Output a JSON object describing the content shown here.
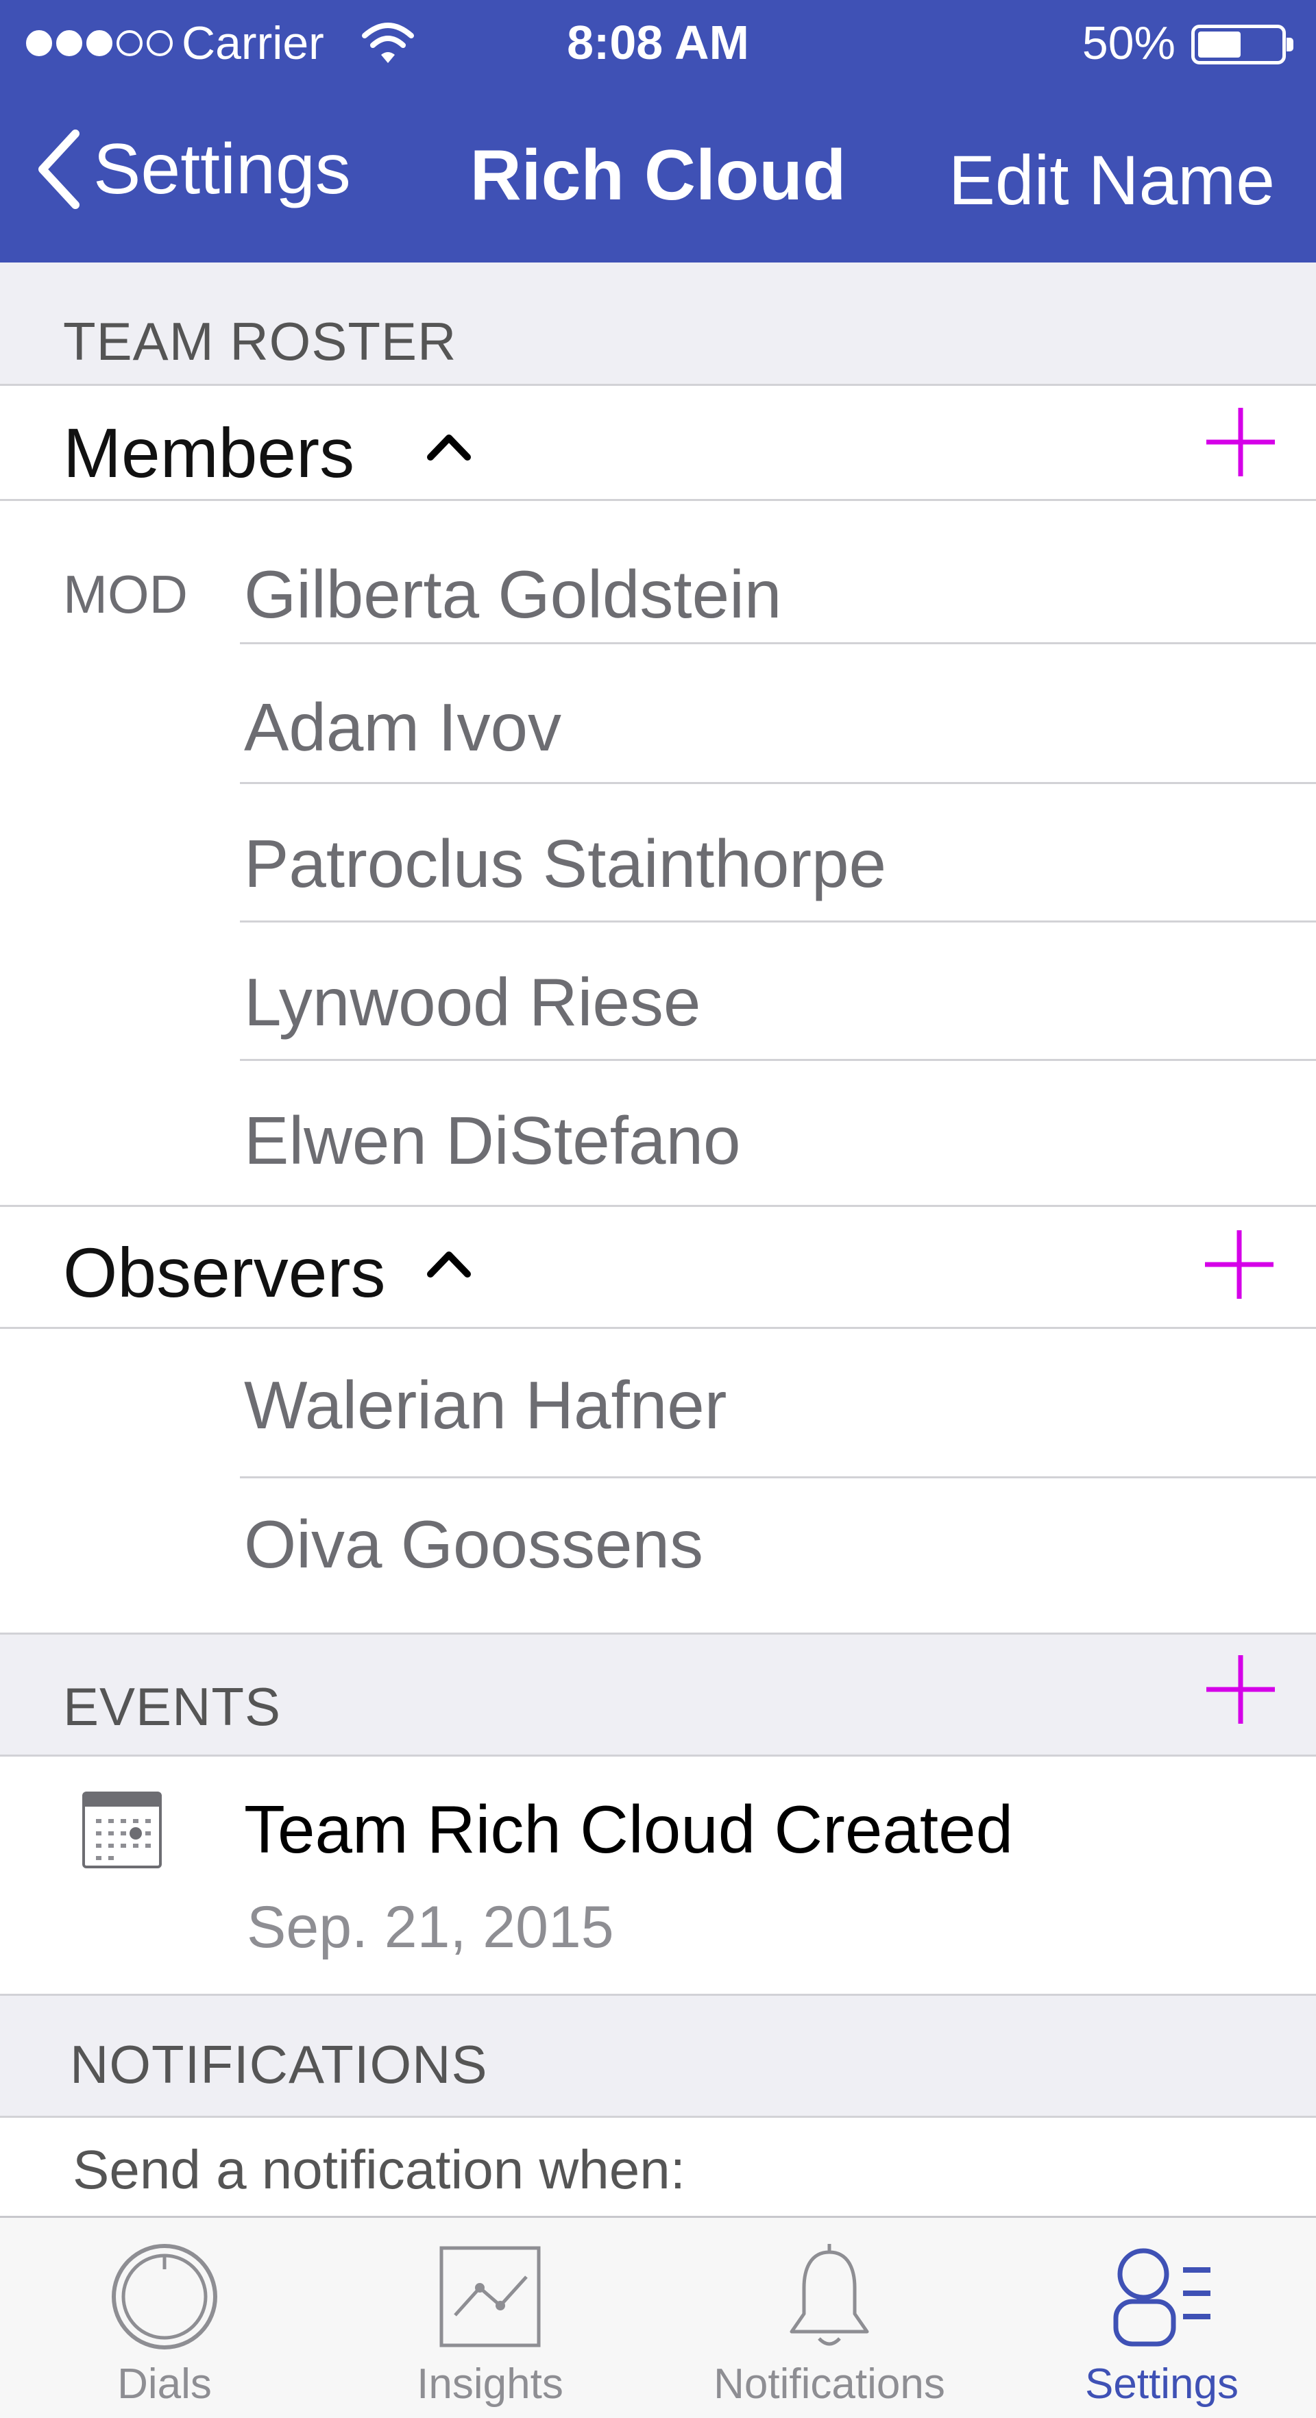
{
  "status_bar": {
    "carrier": "Carrier",
    "time": "8:08 AM",
    "battery_percent": "50%",
    "battery_level": 0.5,
    "signal_bars_filled": 3,
    "signal_bars_total": 5
  },
  "nav": {
    "back_label": "Settings",
    "title": "Rich Cloud",
    "right_action": "Edit Name"
  },
  "team_roster": {
    "header": "TEAM ROSTER",
    "members": {
      "label": "Members",
      "mod_badge": "MOD",
      "items": [
        "Gilberta Goldstein",
        "Adam Ivov",
        "Patroclus Stainthorpe",
        "Lynwood Riese",
        "Elwen DiStefano"
      ]
    },
    "observers": {
      "label": "Observers",
      "items": [
        "Walerian Hafner",
        "Oiva Goossens"
      ]
    }
  },
  "events": {
    "header": "EVENTS",
    "items": [
      {
        "title": "Team Rich Cloud Created",
        "date": "Sep. 21, 2015",
        "icon": "calendar-icon"
      }
    ]
  },
  "notifications": {
    "header": "NOTIFICATIONS",
    "intro": "Send a notification when:"
  },
  "tab_bar": {
    "tabs": [
      {
        "label": "Dials",
        "icon": "dial-icon",
        "active": false
      },
      {
        "label": "Insights",
        "icon": "chart-icon",
        "active": false
      },
      {
        "label": "Notifications",
        "icon": "bell-icon",
        "active": false
      },
      {
        "label": "Settings",
        "icon": "settings-list-icon",
        "active": true
      }
    ]
  },
  "colors": {
    "brand": "#3f51b5",
    "accent_plus": "#d500e8",
    "section_bg": "#efeff4",
    "secondary_text": "#6d6d72"
  }
}
